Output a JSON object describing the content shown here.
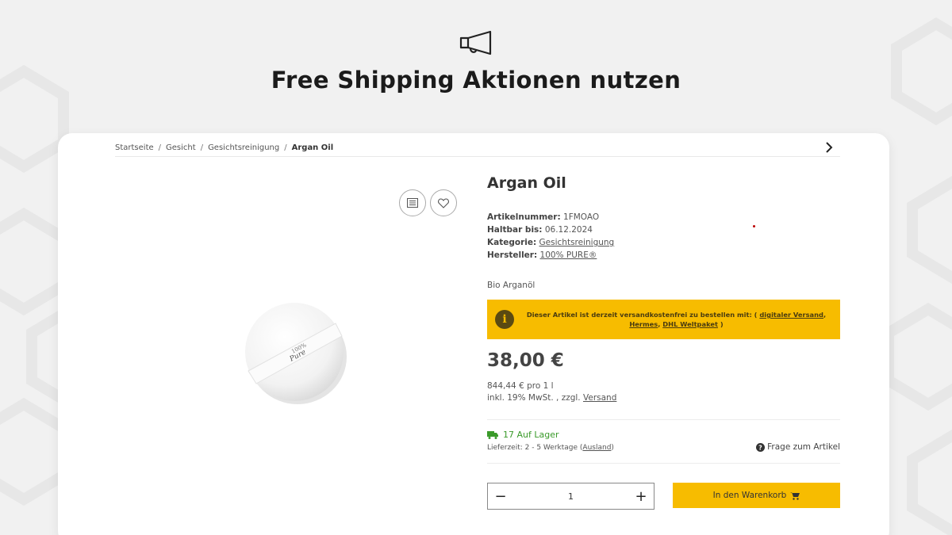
{
  "hero": {
    "title": "Free Shipping Aktionen nutzen",
    "icon": "megaphone-icon"
  },
  "breadcrumb": {
    "items": [
      "Startseite",
      "Gesicht",
      "Gesichtsreinigung"
    ],
    "current": "Argan Oil",
    "separator": "/"
  },
  "product": {
    "title": "Argan Oil",
    "sku_label": "Artikelnummer:",
    "sku": "1FMOAO",
    "best_before_label": "Haltbar bis:",
    "best_before": "06.12.2024",
    "category_label": "Kategorie:",
    "category": "Gesichtsreinigung",
    "manufacturer_label": "Hersteller:",
    "manufacturer": "100% PURE®",
    "short_description": "Bio Arganöl",
    "price": "38,00 €",
    "unit_price": "844,44 € pro 1 l",
    "tax_prefix": "inkl. 19% MwSt. , zzgl.",
    "shipping_link": "Versand",
    "image_label_line1": "100%",
    "image_label_line2": "Pure"
  },
  "notice": {
    "text_before": "Dieser Artikel ist derzeit versandkostenfrei zu bestellen mit: (",
    "link1": "digitaler Versand",
    "link2": "Hermes",
    "link3": "DHL Weltpaket",
    "comma": ",",
    "text_after": ")"
  },
  "stock": {
    "status": "17 Auf Lager",
    "delivery_prefix": "Lieferzeit: 2 - 5 Werktage (",
    "delivery_link": "Ausland",
    "delivery_suffix": ")",
    "question": "Frage zum Artikel"
  },
  "purchase": {
    "quantity": "1",
    "minus": "−",
    "plus": "+",
    "add_to_cart": "In den Warenkorb"
  },
  "colors": {
    "accent": "#f7bc00",
    "stock_green": "#3a9a2a",
    "background": "#f1f1f1"
  }
}
